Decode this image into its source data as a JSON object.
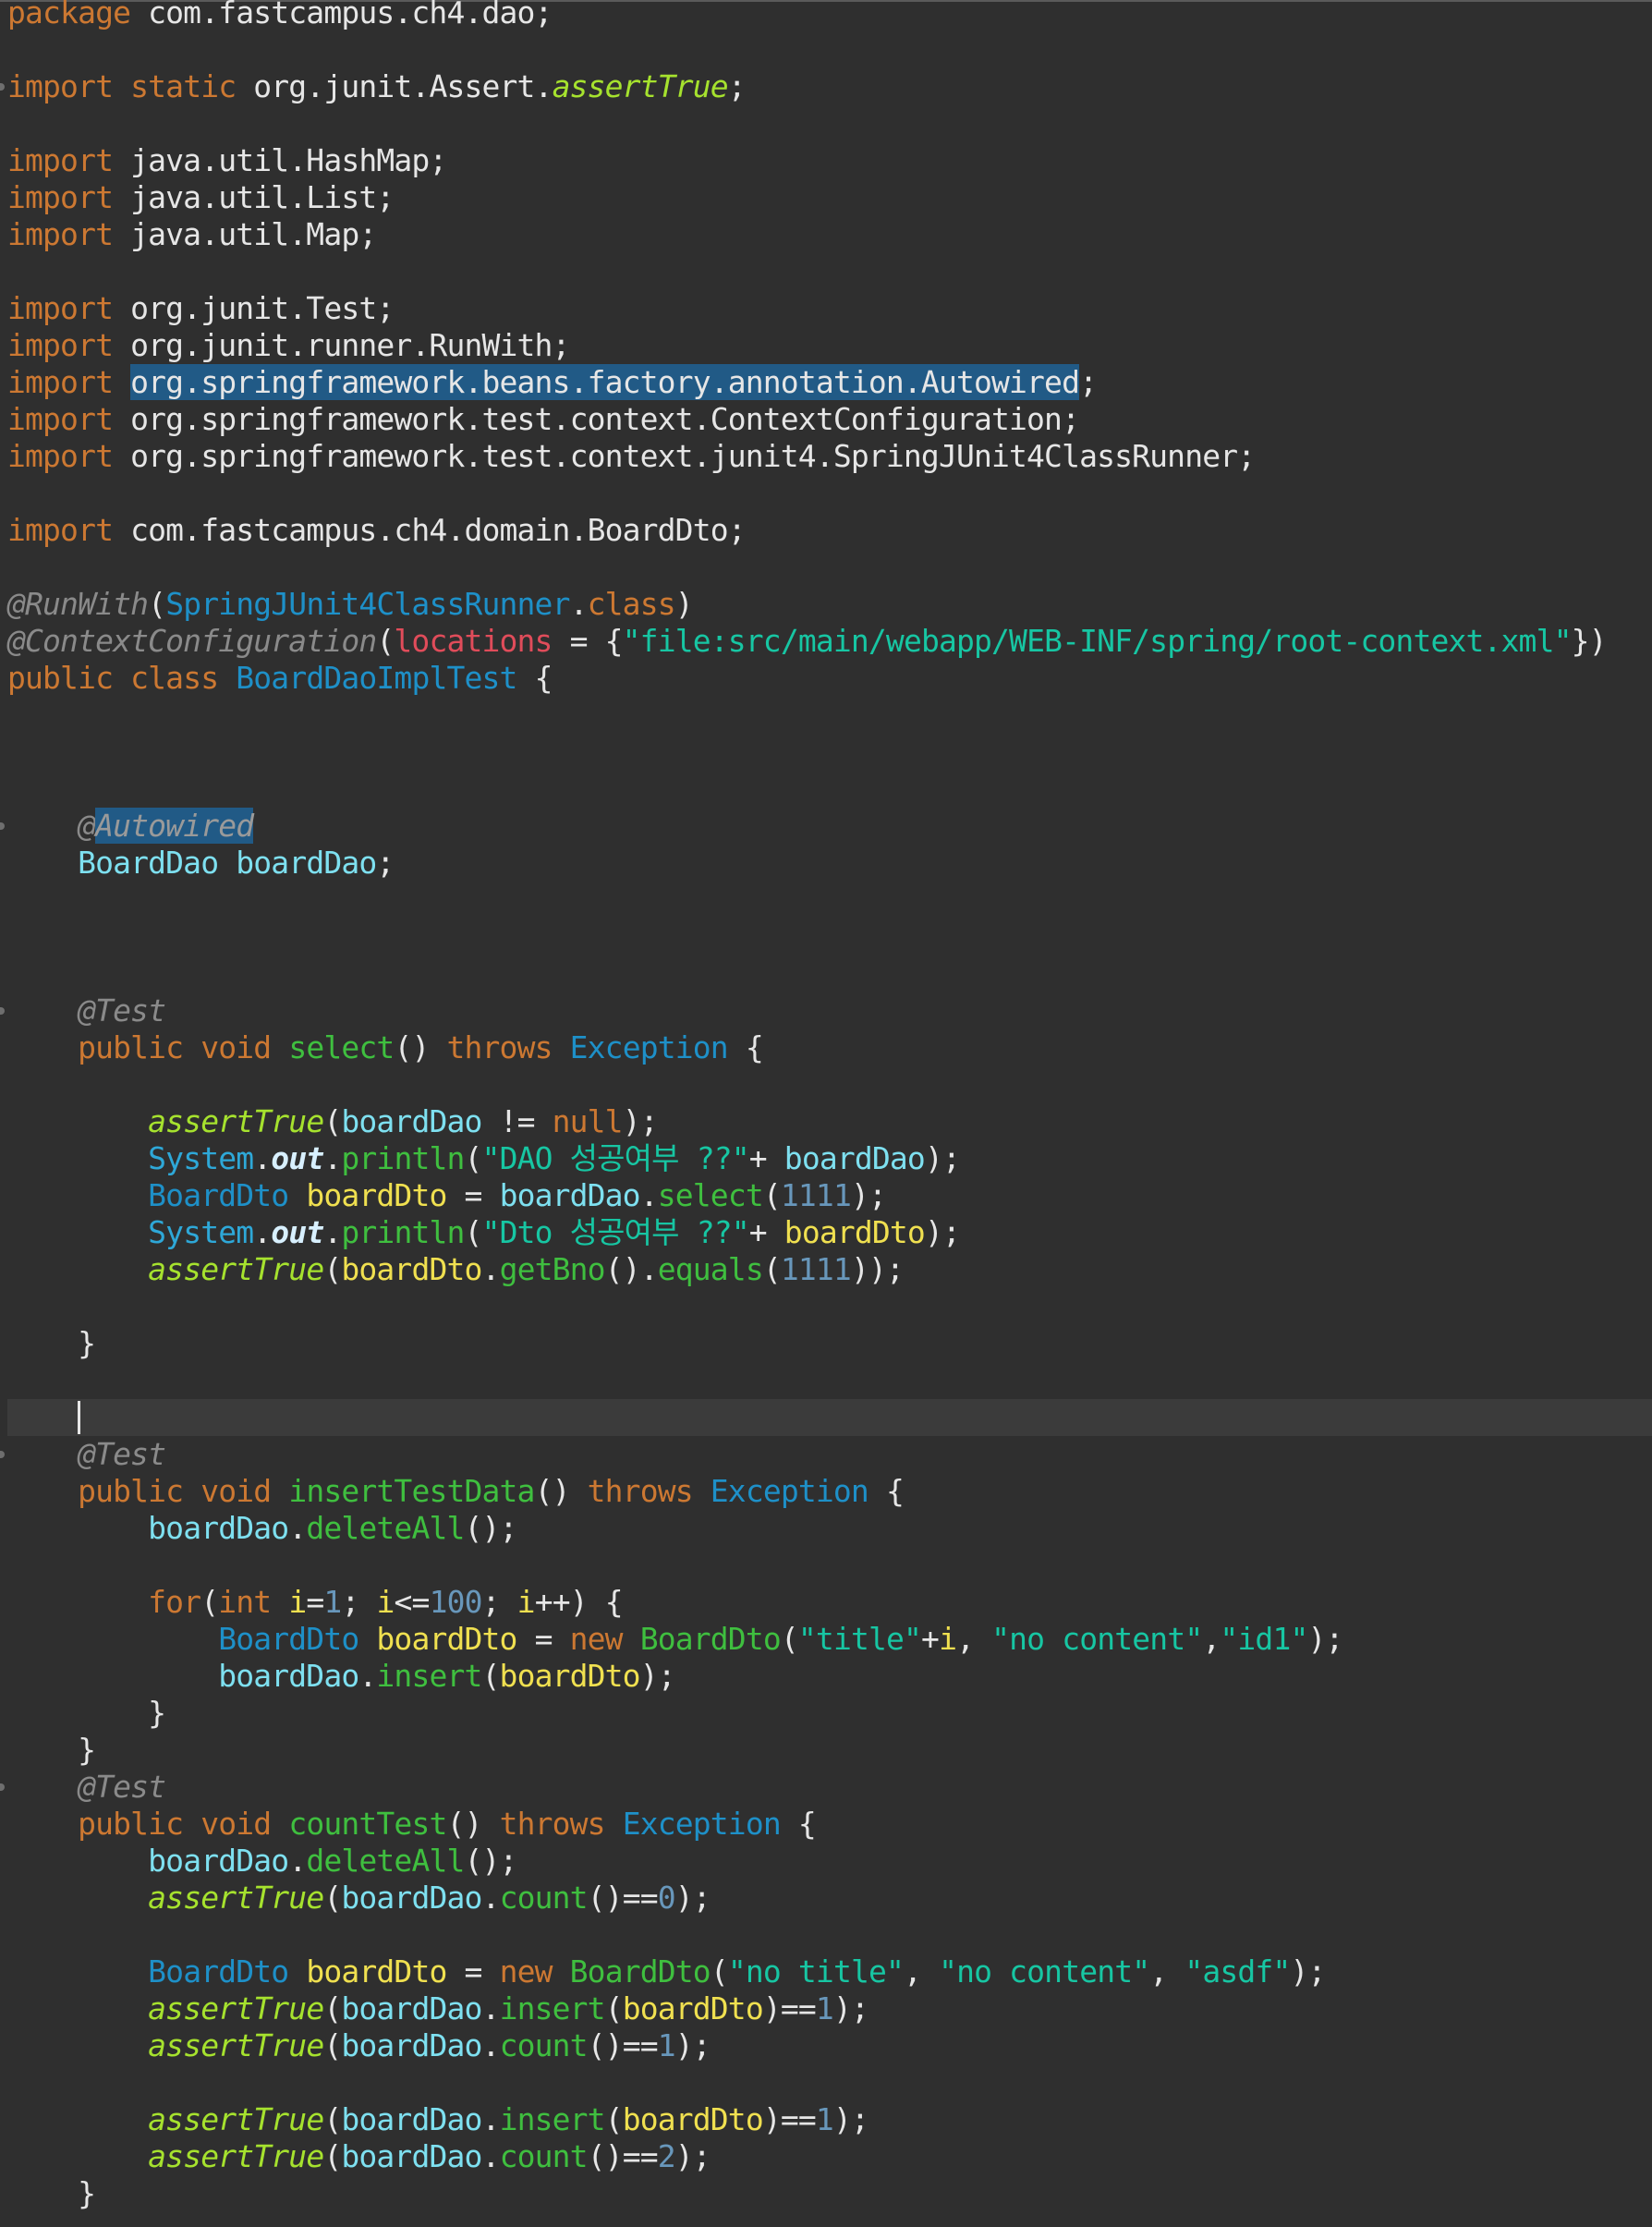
{
  "editor": {
    "language": "Java",
    "theme": "dark",
    "current_line": 38,
    "lines": [
      [
        {
          "t": "package",
          "c": "kw"
        },
        {
          "t": " com.fastcampus.ch4.dao;",
          "c": "text"
        }
      ],
      [],
      [
        {
          "t": "import",
          "c": "kw"
        },
        {
          "t": " ",
          "c": "text"
        },
        {
          "t": "static",
          "c": "kw"
        },
        {
          "t": " org.junit.Assert.",
          "c": "text"
        },
        {
          "t": "assertTrue",
          "c": "static"
        },
        {
          "t": ";",
          "c": "text"
        }
      ],
      [],
      [
        {
          "t": "import",
          "c": "kw"
        },
        {
          "t": " java.util.HashMap;",
          "c": "text"
        }
      ],
      [
        {
          "t": "import",
          "c": "kw"
        },
        {
          "t": " java.util.List;",
          "c": "text"
        }
      ],
      [
        {
          "t": "import",
          "c": "kw"
        },
        {
          "t": " java.util.Map;",
          "c": "text"
        }
      ],
      [],
      [
        {
          "t": "import",
          "c": "kw"
        },
        {
          "t": " org.junit.Test;",
          "c": "text"
        }
      ],
      [
        {
          "t": "import",
          "c": "kw"
        },
        {
          "t": " org.junit.runner.RunWith;",
          "c": "text"
        }
      ],
      [
        {
          "t": "import",
          "c": "kw"
        },
        {
          "t": " ",
          "c": "text"
        },
        {
          "t": "org.springframework.beans.factory.annotation.Autowired",
          "c": "sel"
        },
        {
          "t": ";",
          "c": "text"
        }
      ],
      [
        {
          "t": "import",
          "c": "kw"
        },
        {
          "t": " org.springframework.test.context.ContextConfiguration;",
          "c": "text"
        }
      ],
      [
        {
          "t": "import",
          "c": "kw"
        },
        {
          "t": " org.springframework.test.context.junit4.SpringJUnit4ClassRunner;",
          "c": "text"
        }
      ],
      [],
      [
        {
          "t": "import",
          "c": "kw"
        },
        {
          "t": " com.fastcampus.ch4.domain.BoardDto;",
          "c": "text"
        }
      ],
      [],
      [
        {
          "t": "@RunWith",
          "c": "anno"
        },
        {
          "t": "(",
          "c": "text"
        },
        {
          "t": "SpringJUnit4ClassRunner",
          "c": "type"
        },
        {
          "t": ".",
          "c": "text"
        },
        {
          "t": "class",
          "c": "kw"
        },
        {
          "t": ")",
          "c": "text"
        }
      ],
      [
        {
          "t": "@ContextConfiguration",
          "c": "anno"
        },
        {
          "t": "(",
          "c": "text"
        },
        {
          "t": "locations",
          "c": "param"
        },
        {
          "t": " = {",
          "c": "text"
        },
        {
          "t": "\"file:src/main/webapp/WEB-INF/spring/root-context.xml\"",
          "c": "str"
        },
        {
          "t": "})",
          "c": "text"
        }
      ],
      [
        {
          "t": "public",
          "c": "kw"
        },
        {
          "t": " ",
          "c": "text"
        },
        {
          "t": "class",
          "c": "kw"
        },
        {
          "t": " ",
          "c": "text"
        },
        {
          "t": "BoardDaoImplTest",
          "c": "type"
        },
        {
          "t": " {",
          "c": "text"
        }
      ],
      [],
      [],
      [],
      [
        {
          "t": "    ",
          "c": "text"
        },
        {
          "t": "@",
          "c": "anno"
        },
        {
          "t": "Autowired",
          "c": "selanno"
        }
      ],
      [
        {
          "t": "    ",
          "c": "text"
        },
        {
          "t": "BoardDao",
          "c": "field"
        },
        {
          "t": " ",
          "c": "text"
        },
        {
          "t": "boardDao",
          "c": "field"
        },
        {
          "t": ";",
          "c": "text"
        }
      ],
      [],
      [],
      [],
      [
        {
          "t": "    ",
          "c": "text"
        },
        {
          "t": "@Test",
          "c": "anno"
        }
      ],
      [
        {
          "t": "    ",
          "c": "text"
        },
        {
          "t": "public",
          "c": "kw"
        },
        {
          "t": " ",
          "c": "text"
        },
        {
          "t": "void",
          "c": "kw"
        },
        {
          "t": " ",
          "c": "text"
        },
        {
          "t": "select",
          "c": "method"
        },
        {
          "t": "() ",
          "c": "text"
        },
        {
          "t": "throws",
          "c": "kw"
        },
        {
          "t": " ",
          "c": "text"
        },
        {
          "t": "Exception",
          "c": "type"
        },
        {
          "t": " {",
          "c": "text"
        }
      ],
      [],
      [
        {
          "t": "        ",
          "c": "text"
        },
        {
          "t": "assertTrue",
          "c": "static"
        },
        {
          "t": "(",
          "c": "text"
        },
        {
          "t": "boardDao",
          "c": "field"
        },
        {
          "t": " != ",
          "c": "text"
        },
        {
          "t": "null",
          "c": "kw"
        },
        {
          "t": ");",
          "c": "text"
        }
      ],
      [
        {
          "t": "        ",
          "c": "text"
        },
        {
          "t": "System",
          "c": "class"
        },
        {
          "t": ".",
          "c": "text"
        },
        {
          "t": "out",
          "c": "out"
        },
        {
          "t": ".",
          "c": "text"
        },
        {
          "t": "println",
          "c": "method"
        },
        {
          "t": "(",
          "c": "text"
        },
        {
          "t": "\"DAO 성공여부 ??\"",
          "c": "str"
        },
        {
          "t": "+ ",
          "c": "text"
        },
        {
          "t": "boardDao",
          "c": "field"
        },
        {
          "t": ");",
          "c": "text"
        }
      ],
      [
        {
          "t": "        ",
          "c": "text"
        },
        {
          "t": "BoardDto",
          "c": "type"
        },
        {
          "t": " ",
          "c": "text"
        },
        {
          "t": "boardDto",
          "c": "local"
        },
        {
          "t": " = ",
          "c": "text"
        },
        {
          "t": "boardDao",
          "c": "field"
        },
        {
          "t": ".",
          "c": "text"
        },
        {
          "t": "select",
          "c": "method"
        },
        {
          "t": "(",
          "c": "text"
        },
        {
          "t": "1111",
          "c": "num"
        },
        {
          "t": ");",
          "c": "text"
        }
      ],
      [
        {
          "t": "        ",
          "c": "text"
        },
        {
          "t": "System",
          "c": "class"
        },
        {
          "t": ".",
          "c": "text"
        },
        {
          "t": "out",
          "c": "out"
        },
        {
          "t": ".",
          "c": "text"
        },
        {
          "t": "println",
          "c": "method"
        },
        {
          "t": "(",
          "c": "text"
        },
        {
          "t": "\"Dto 성공여부 ??\"",
          "c": "str"
        },
        {
          "t": "+ ",
          "c": "text"
        },
        {
          "t": "boardDto",
          "c": "local"
        },
        {
          "t": ");",
          "c": "text"
        }
      ],
      [
        {
          "t": "        ",
          "c": "text"
        },
        {
          "t": "assertTrue",
          "c": "static"
        },
        {
          "t": "(",
          "c": "text"
        },
        {
          "t": "boardDto",
          "c": "local"
        },
        {
          "t": ".",
          "c": "text"
        },
        {
          "t": "getBno",
          "c": "method"
        },
        {
          "t": "().",
          "c": "text"
        },
        {
          "t": "equals",
          "c": "method"
        },
        {
          "t": "(",
          "c": "text"
        },
        {
          "t": "1111",
          "c": "num"
        },
        {
          "t": "));",
          "c": "text"
        }
      ],
      [],
      [
        {
          "t": "    }",
          "c": "text"
        }
      ],
      [],
      [
        {
          "t": "    ",
          "c": "text"
        }
      ],
      [
        {
          "t": "    ",
          "c": "text"
        },
        {
          "t": "@Test",
          "c": "anno"
        }
      ],
      [
        {
          "t": "    ",
          "c": "text"
        },
        {
          "t": "public",
          "c": "kw"
        },
        {
          "t": " ",
          "c": "text"
        },
        {
          "t": "void",
          "c": "kw"
        },
        {
          "t": " ",
          "c": "text"
        },
        {
          "t": "insertTestData",
          "c": "method"
        },
        {
          "t": "() ",
          "c": "text"
        },
        {
          "t": "throws",
          "c": "kw"
        },
        {
          "t": " ",
          "c": "text"
        },
        {
          "t": "Exception",
          "c": "type"
        },
        {
          "t": " {",
          "c": "text"
        }
      ],
      [
        {
          "t": "        ",
          "c": "text"
        },
        {
          "t": "boardDao",
          "c": "field"
        },
        {
          "t": ".",
          "c": "text"
        },
        {
          "t": "deleteAll",
          "c": "method"
        },
        {
          "t": "();",
          "c": "text"
        }
      ],
      [],
      [
        {
          "t": "        ",
          "c": "text"
        },
        {
          "t": "for",
          "c": "kw"
        },
        {
          "t": "(",
          "c": "text"
        },
        {
          "t": "int",
          "c": "kw"
        },
        {
          "t": " ",
          "c": "text"
        },
        {
          "t": "i",
          "c": "local"
        },
        {
          "t": "=",
          "c": "text"
        },
        {
          "t": "1",
          "c": "num"
        },
        {
          "t": "; ",
          "c": "text"
        },
        {
          "t": "i",
          "c": "local"
        },
        {
          "t": "<=",
          "c": "text"
        },
        {
          "t": "100",
          "c": "num"
        },
        {
          "t": "; ",
          "c": "text"
        },
        {
          "t": "i",
          "c": "local"
        },
        {
          "t": "++) {",
          "c": "text"
        }
      ],
      [
        {
          "t": "            ",
          "c": "text"
        },
        {
          "t": "BoardDto",
          "c": "type"
        },
        {
          "t": " ",
          "c": "text"
        },
        {
          "t": "boardDto",
          "c": "local"
        },
        {
          "t": " = ",
          "c": "text"
        },
        {
          "t": "new",
          "c": "kw"
        },
        {
          "t": " ",
          "c": "text"
        },
        {
          "t": "BoardDto",
          "c": "method"
        },
        {
          "t": "(",
          "c": "text"
        },
        {
          "t": "\"title\"",
          "c": "str"
        },
        {
          "t": "+",
          "c": "text"
        },
        {
          "t": "i",
          "c": "local"
        },
        {
          "t": ", ",
          "c": "text"
        },
        {
          "t": "\"no content\"",
          "c": "str"
        },
        {
          "t": ",",
          "c": "text"
        },
        {
          "t": "\"id1\"",
          "c": "str"
        },
        {
          "t": ");",
          "c": "text"
        }
      ],
      [
        {
          "t": "            ",
          "c": "text"
        },
        {
          "t": "boardDao",
          "c": "field"
        },
        {
          "t": ".",
          "c": "text"
        },
        {
          "t": "insert",
          "c": "method"
        },
        {
          "t": "(",
          "c": "text"
        },
        {
          "t": "boardDto",
          "c": "local"
        },
        {
          "t": ");",
          "c": "text"
        }
      ],
      [
        {
          "t": "        }",
          "c": "text"
        }
      ],
      [
        {
          "t": "    }",
          "c": "text"
        }
      ],
      [
        {
          "t": "    ",
          "c": "text"
        },
        {
          "t": "@Test",
          "c": "anno"
        }
      ],
      [
        {
          "t": "    ",
          "c": "text"
        },
        {
          "t": "public",
          "c": "kw"
        },
        {
          "t": " ",
          "c": "text"
        },
        {
          "t": "void",
          "c": "kw"
        },
        {
          "t": " ",
          "c": "text"
        },
        {
          "t": "countTest",
          "c": "method"
        },
        {
          "t": "() ",
          "c": "text"
        },
        {
          "t": "throws",
          "c": "kw"
        },
        {
          "t": " ",
          "c": "text"
        },
        {
          "t": "Exception",
          "c": "type"
        },
        {
          "t": " {",
          "c": "text"
        }
      ],
      [
        {
          "t": "        ",
          "c": "text"
        },
        {
          "t": "boardDao",
          "c": "field"
        },
        {
          "t": ".",
          "c": "text"
        },
        {
          "t": "deleteAll",
          "c": "method"
        },
        {
          "t": "();",
          "c": "text"
        }
      ],
      [
        {
          "t": "        ",
          "c": "text"
        },
        {
          "t": "assertTrue",
          "c": "static"
        },
        {
          "t": "(",
          "c": "text"
        },
        {
          "t": "boardDao",
          "c": "field"
        },
        {
          "t": ".",
          "c": "text"
        },
        {
          "t": "count",
          "c": "method"
        },
        {
          "t": "()==",
          "c": "text"
        },
        {
          "t": "0",
          "c": "num"
        },
        {
          "t": ");",
          "c": "text"
        }
      ],
      [],
      [
        {
          "t": "        ",
          "c": "text"
        },
        {
          "t": "BoardDto",
          "c": "type"
        },
        {
          "t": " ",
          "c": "text"
        },
        {
          "t": "boardDto",
          "c": "local"
        },
        {
          "t": " = ",
          "c": "text"
        },
        {
          "t": "new",
          "c": "kw"
        },
        {
          "t": " ",
          "c": "text"
        },
        {
          "t": "BoardDto",
          "c": "method"
        },
        {
          "t": "(",
          "c": "text"
        },
        {
          "t": "\"no title\"",
          "c": "str"
        },
        {
          "t": ", ",
          "c": "text"
        },
        {
          "t": "\"no content\"",
          "c": "str"
        },
        {
          "t": ", ",
          "c": "text"
        },
        {
          "t": "\"asdf\"",
          "c": "str"
        },
        {
          "t": ");",
          "c": "text"
        }
      ],
      [
        {
          "t": "        ",
          "c": "text"
        },
        {
          "t": "assertTrue",
          "c": "static"
        },
        {
          "t": "(",
          "c": "text"
        },
        {
          "t": "boardDao",
          "c": "field"
        },
        {
          "t": ".",
          "c": "text"
        },
        {
          "t": "insert",
          "c": "method"
        },
        {
          "t": "(",
          "c": "text"
        },
        {
          "t": "boardDto",
          "c": "local"
        },
        {
          "t": ")==",
          "c": "text"
        },
        {
          "t": "1",
          "c": "num"
        },
        {
          "t": ");",
          "c": "text"
        }
      ],
      [
        {
          "t": "        ",
          "c": "text"
        },
        {
          "t": "assertTrue",
          "c": "static"
        },
        {
          "t": "(",
          "c": "text"
        },
        {
          "t": "boardDao",
          "c": "field"
        },
        {
          "t": ".",
          "c": "text"
        },
        {
          "t": "count",
          "c": "method"
        },
        {
          "t": "()==",
          "c": "text"
        },
        {
          "t": "1",
          "c": "num"
        },
        {
          "t": ");",
          "c": "text"
        }
      ],
      [],
      [
        {
          "t": "        ",
          "c": "text"
        },
        {
          "t": "assertTrue",
          "c": "static"
        },
        {
          "t": "(",
          "c": "text"
        },
        {
          "t": "boardDao",
          "c": "field"
        },
        {
          "t": ".",
          "c": "text"
        },
        {
          "t": "insert",
          "c": "method"
        },
        {
          "t": "(",
          "c": "text"
        },
        {
          "t": "boardDto",
          "c": "local"
        },
        {
          "t": ")==",
          "c": "text"
        },
        {
          "t": "1",
          "c": "num"
        },
        {
          "t": ");",
          "c": "text"
        }
      ],
      [
        {
          "t": "        ",
          "c": "text"
        },
        {
          "t": "assertTrue",
          "c": "static"
        },
        {
          "t": "(",
          "c": "text"
        },
        {
          "t": "boardDao",
          "c": "field"
        },
        {
          "t": ".",
          "c": "text"
        },
        {
          "t": "count",
          "c": "method"
        },
        {
          "t": "()==",
          "c": "text"
        },
        {
          "t": "2",
          "c": "num"
        },
        {
          "t": ");",
          "c": "text"
        }
      ],
      [
        {
          "t": "    }",
          "c": "text"
        }
      ]
    ],
    "gutter_markers": [
      2,
      22,
      27,
      39,
      48
    ]
  }
}
